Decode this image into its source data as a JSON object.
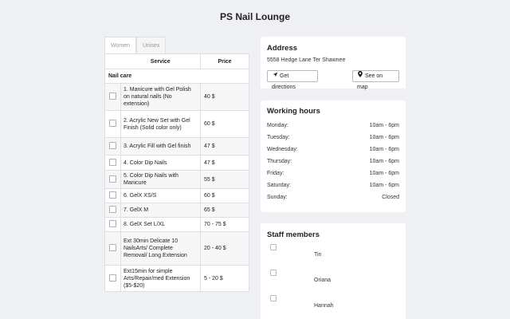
{
  "page": {
    "title": "PS Nail Lounge"
  },
  "tabs": [
    {
      "label": "Women",
      "active": true
    },
    {
      "label": "Unisex",
      "active": false
    }
  ],
  "services": {
    "headers": {
      "service": "Service",
      "price": "Price"
    },
    "category": "Nail care",
    "items": [
      {
        "name": "1. Manicure with Gel Polish on natural nails (No extension)",
        "price": "40 $"
      },
      {
        "name": "2. Acrylic New Set with Gel Finish (Solid color only)",
        "price": "60 $"
      },
      {
        "name": "3. Acrylic Fill with Gel finish",
        "price": "47 $"
      },
      {
        "name": "4. Color Dip Nails",
        "price": "47 $"
      },
      {
        "name": "5. Color Dip Nails with Manicure",
        "price": "55 $"
      },
      {
        "name": "6. GelX XS/S",
        "price": "60 $"
      },
      {
        "name": "7. GelX M",
        "price": "65 $"
      },
      {
        "name": "8. GelX Set L/XL",
        "price": "70 - 75 $"
      },
      {
        "name": "Ext 30min Delicate 10 NailsArts/ Complete Removal/ Long Extension",
        "price": "20 - 40 $"
      },
      {
        "name": "Ext15min for simple Arts/Repair/med Extension ($5-$20)",
        "price": "5 - 20 $"
      }
    ]
  },
  "address": {
    "heading": "Address",
    "line": "5558 Hedge Lane Ter Shawnee",
    "directions_label": "Get directions",
    "map_label": "See on map",
    "directions_icon": "navigation-arrow-icon",
    "map_icon": "map-pin-icon"
  },
  "hours": {
    "heading": "Working hours",
    "days": [
      {
        "day": "Monday:",
        "time": "10am - 6pm"
      },
      {
        "day": "Tuesday:",
        "time": "10am - 6pm"
      },
      {
        "day": "Wednesday:",
        "time": "10am - 6pm"
      },
      {
        "day": "Thursday:",
        "time": "10am - 6pm"
      },
      {
        "day": "Friday:",
        "time": "10am - 6pm"
      },
      {
        "day": "Saturday:",
        "time": "10am - 6pm"
      },
      {
        "day": "Sunday:",
        "time": "Closed"
      }
    ]
  },
  "staff": {
    "heading": "Staff members",
    "members": [
      {
        "name": "Tin"
      },
      {
        "name": "Oriana"
      },
      {
        "name": "Hannah"
      }
    ]
  }
}
